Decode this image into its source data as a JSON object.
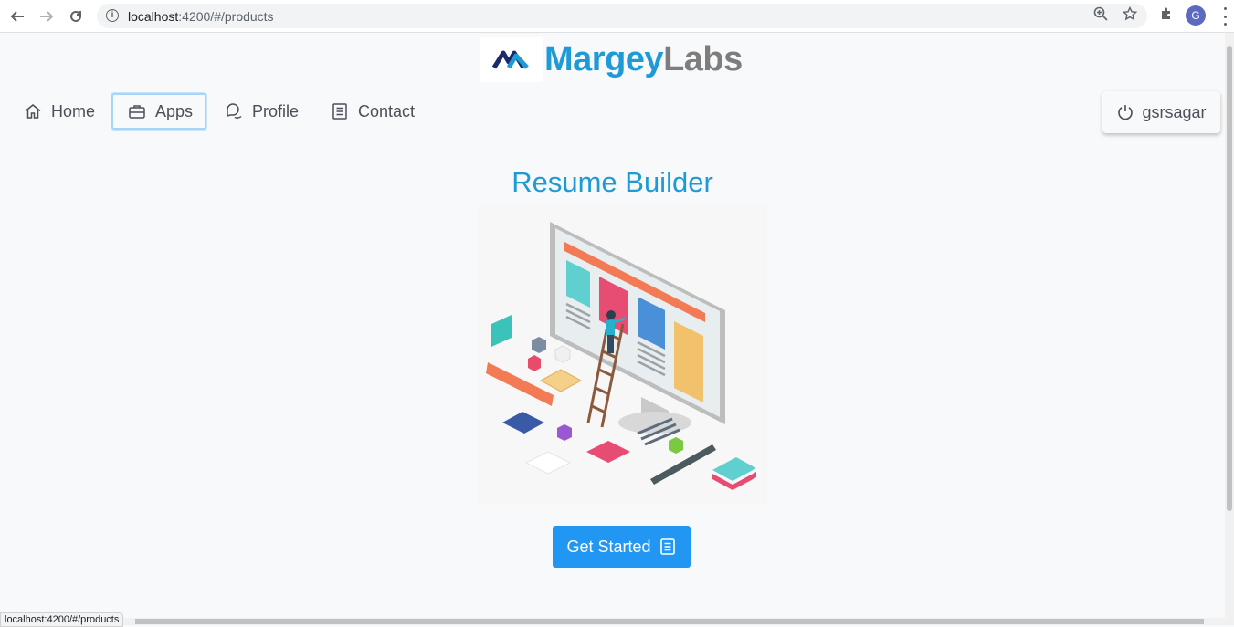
{
  "browser": {
    "url_host": "localhost",
    "url_path": ":4200/#/products",
    "profile_initial": "G",
    "status_url": "localhost:4200/#/products"
  },
  "brand": {
    "name_part1": "Margey",
    "name_part2": "Labs",
    "color_primary": "#1e9ad6",
    "color_secondary": "#7d7d7d"
  },
  "nav": {
    "items": [
      {
        "label": "Home",
        "icon": "home-icon"
      },
      {
        "label": "Apps",
        "icon": "briefcase-icon",
        "active": true
      },
      {
        "label": "Profile",
        "icon": "comments-icon"
      },
      {
        "label": "Contact",
        "icon": "book-icon"
      }
    ],
    "user": {
      "label": "gsrsagar",
      "icon": "power-off-icon"
    }
  },
  "main": {
    "title": "Resume Builder",
    "cta_label": "Get Started",
    "cta_icon": "book-icon",
    "cta_color": "#2196f3"
  }
}
